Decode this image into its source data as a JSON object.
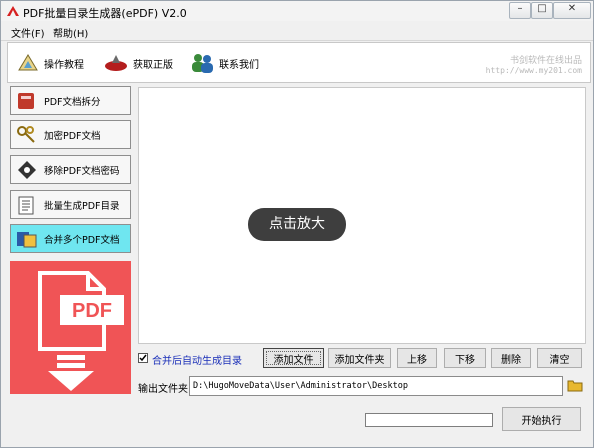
{
  "window": {
    "title": "PDF批量目录生成器(ePDF) V2.0"
  },
  "menu": [
    "文件(F)",
    "帮助(H)"
  ],
  "toolbar": {
    "tutorial": "操作教程",
    "get_genuine": "获取正版",
    "contact": "联系我们",
    "watermark_text": "书剑软件在线出品",
    "watermark_url": "http://www.my201.com"
  },
  "sidebar": {
    "items": [
      "PDF文档拆分",
      "加密PDF文档",
      "移除PDF文档密码",
      "批量生成PDF目录",
      "合并多个PDF文档"
    ],
    "active_index": 4,
    "banner_label": "PDF"
  },
  "content": {
    "overlay_text": "点击放大"
  },
  "options": {
    "auto_toc_label": "合并后自动生成目录",
    "auto_toc_checked": true
  },
  "actions": {
    "add_file": "添加文件",
    "add_folder": "添加文件夹",
    "move_up": "上移",
    "move_down": "下移",
    "delete": "删除",
    "clear": "清空"
  },
  "output": {
    "label": "输出文件夹",
    "path": "D:\\HugoMoveData\\User\\Administrator\\Desktop"
  },
  "run": {
    "start_label": "开始执行",
    "progress": 0
  },
  "colors": {
    "active_item": "#6fe6f0",
    "banner": "#f05456",
    "option_text": "#1a2fb8"
  }
}
